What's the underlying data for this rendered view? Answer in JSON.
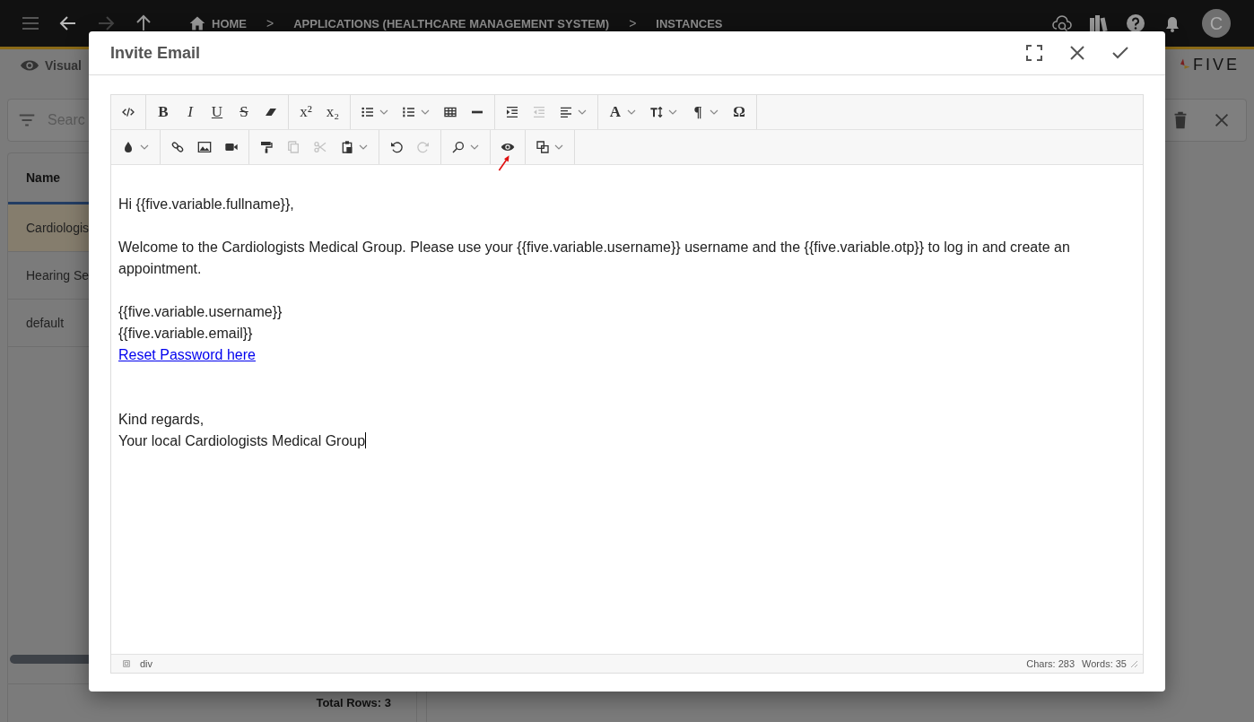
{
  "top_bar": {
    "breadcrumb": [
      {
        "label": "HOME"
      },
      {
        "label": "APPLICATIONS (HEALTHCARE MANAGEMENT SYSTEM)"
      },
      {
        "label": "INSTANCES"
      }
    ],
    "separator": ">",
    "avatar": "C"
  },
  "sub_bar": {
    "view": "Visual",
    "logo": "FIVE"
  },
  "list_panel": {
    "search": {
      "placeholder": "Searc"
    },
    "column": "Name",
    "rows": [
      {
        "name": "Cardiologis",
        "selected": true
      },
      {
        "name": "Hearing Se",
        "selected": false
      },
      {
        "name": "default",
        "selected": false
      }
    ],
    "total": "Total Rows: 3"
  },
  "dialog": {
    "title": "Invite Email",
    "toolbar": [
      [
        [
          {
            "disabled": false,
            "dropdown": false
          }
        ],
        [
          {
            "label": "B",
            "disabled": false,
            "dropdown": false
          },
          {
            "label": "I",
            "disabled": false,
            "dropdown": false
          },
          {
            "label": "U",
            "disabled": false,
            "dropdown": false
          },
          {
            "label": "S",
            "disabled": false,
            "dropdown": false
          },
          {
            "disabled": false,
            "dropdown": false
          }
        ],
        [
          {
            "label": "x²",
            "disabled": false,
            "dropdown": false
          },
          {
            "label": "x₂",
            "disabled": false,
            "dropdown": false
          }
        ],
        [
          {
            "disabled": false,
            "dropdown": true
          },
          {
            "disabled": false,
            "dropdown": true
          },
          {
            "disabled": false,
            "dropdown": false
          },
          {
            "disabled": false,
            "dropdown": false
          }
        ],
        [
          {
            "disabled": false,
            "dropdown": false
          },
          {
            "disabled": true,
            "dropdown": false
          },
          {
            "disabled": false,
            "dropdown": true
          }
        ],
        [
          {
            "label": "A",
            "disabled": false,
            "dropdown": true
          },
          {
            "disabled": false,
            "dropdown": true
          },
          {
            "label": "¶",
            "disabled": false,
            "dropdown": true
          },
          {
            "label": "Ω",
            "disabled": false,
            "dropdown": false
          }
        ]
      ],
      [
        [
          {
            "disabled": false,
            "dropdown": true
          }
        ],
        [
          {
            "disabled": false,
            "dropdown": false
          },
          {
            "disabled": false,
            "dropdown": false
          },
          {
            "disabled": false,
            "dropdown": false
          }
        ],
        [
          {
            "disabled": false,
            "dropdown": false
          },
          {
            "disabled": true,
            "dropdown": false
          },
          {
            "disabled": true,
            "dropdown": false
          },
          {
            "disabled": false,
            "dropdown": true
          }
        ],
        [
          {
            "disabled": false,
            "dropdown": false
          },
          {
            "disabled": true,
            "dropdown": false
          }
        ],
        [
          {
            "disabled": false,
            "dropdown": true
          }
        ],
        [
          {
            "disabled": false,
            "dropdown": false
          }
        ],
        [
          {
            "disabled": false,
            "dropdown": true
          }
        ]
      ]
    ],
    "body": [
      {
        "kind": "blank"
      },
      {
        "kind": "text",
        "text": "Hi {{five.variable.fullname}},"
      },
      {
        "kind": "blank"
      },
      {
        "kind": "text",
        "text": "Welcome to the Cardiologists Medical Group. Please use your {{five.variable.username}} username and the {{five.variable.otp}} to log in and create an appointment."
      },
      {
        "kind": "blank"
      },
      {
        "kind": "text",
        "text": "{{five.variable.username}}"
      },
      {
        "kind": "text",
        "text": "{{five.variable.email}}"
      },
      {
        "kind": "link",
        "text": "Reset Password here"
      },
      {
        "kind": "blank"
      },
      {
        "kind": "blank"
      },
      {
        "kind": "text",
        "text": "Kind regards,"
      },
      {
        "kind": "text",
        "text": "Your local Cardiologists Medical Group",
        "cursor": true
      }
    ],
    "status": {
      "path": "div",
      "chars": "Chars: 283",
      "words": "Words: 35"
    }
  }
}
